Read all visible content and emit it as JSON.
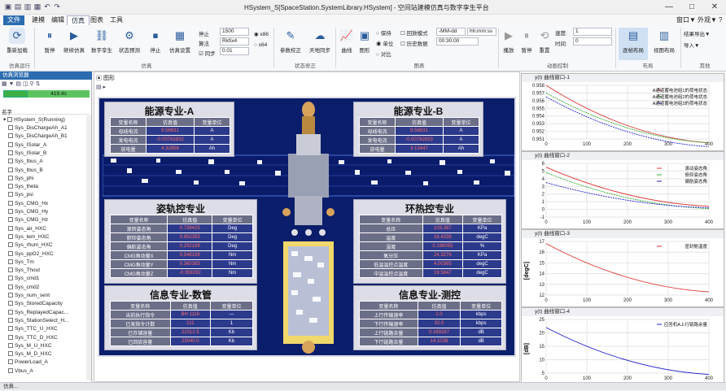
{
  "window": {
    "title": "HSystem_S[SpaceStation.SystemLibrary.HSystem] - 空间站建模仿真与数字孪生平台",
    "min": "—",
    "max": "□",
    "close": "✕"
  },
  "menu": [
    "文件",
    "建模",
    "编辑",
    "仿真",
    "图表",
    "工具"
  ],
  "menu_right": [
    "窗口▼",
    "外观▼",
    "?"
  ],
  "ribbon": {
    "buttons": [
      {
        "label": "重新加载",
        "icon": "reload-icon"
      },
      {
        "label": "暂停",
        "icon": "pause-icon"
      },
      {
        "label": "继续仿真",
        "icon": "play-icon"
      },
      {
        "label": "数字孪生",
        "icon": "link-icon"
      },
      {
        "label": "状态预测",
        "icon": "predict-icon"
      },
      {
        "label": "停止",
        "icon": "stop-icon"
      },
      {
        "label": "仿真设置",
        "icon": "settings-icon"
      }
    ],
    "stop_label": "停止",
    "stop_value": "1500",
    "algo_label": "算法",
    "algo_value": "Rkfix4",
    "step_label": "同步",
    "step_value": "0.01",
    "x86": "x86",
    "x64": "x64",
    "state_buttons": [
      {
        "label": "参数校正",
        "icon": "adjust-icon"
      },
      {
        "label": "天地同步",
        "icon": "cloud-icon"
      }
    ],
    "view_buttons": [
      {
        "label": "曲线",
        "icon": "curve-icon"
      },
      {
        "label": "图形",
        "icon": "shape-icon"
      }
    ],
    "radio": [
      "保持",
      "单位",
      "对比"
    ],
    "check_mode": "回放模式",
    "check_data": "历史数据",
    "date_fmt": "-MM-dd",
    "time_fmt": "hh:mm:ss",
    "time_value": "00:30:00",
    "play_buttons": [
      "播放",
      "暂停",
      "重置"
    ],
    "speed_label": "速度:",
    "speed_value": "1",
    "time_label": "时间:",
    "time_input": "0",
    "layout_buttons": [
      {
        "label": "逐帧布局",
        "icon": "layout-icon"
      },
      {
        "label": "视图布局",
        "icon": "view-icon"
      }
    ],
    "other_buttons": [
      "结果导出▼",
      "导入▼"
    ],
    "groups": [
      "仿真运行",
      "仿真",
      "状态修正",
      "图表",
      "动画控制",
      "布局",
      "其他"
    ]
  },
  "left": {
    "title": "仿真浏览器",
    "time": "419.4s",
    "col": "名字",
    "root": "HSystem_S(Running)",
    "items": [
      "Sys_DisChargeAh_A1",
      "Sys_DisChargeAh_B1",
      "Sys_ISolar_A",
      "Sys_ISolar_B",
      "Sys_Ibus_A",
      "Sys_Ibus_B",
      "Sys_phi",
      "Sys_theta",
      "Sys_psi",
      "Sys_CMG_Hx",
      "Sys_CMG_Hy",
      "Sys_CMG_Hz",
      "Sys_air_HXC",
      "Sys_tem_HXC",
      "Sys_rhum_HXC",
      "Sys_ppO2_HXC",
      "Sys_Tm",
      "Sys_Thout",
      "Sys_cmd1",
      "Sys_cmd2",
      "Sys_num_sent",
      "Sys_StoredCapacity",
      "Sys_ReplayedCapac...",
      "Sys_StationSelect_H...",
      "Sys_TTC_U_HXC",
      "Sys_TTC_D_HXC",
      "Sys_M_U_HXC",
      "Sys_M_D_HXC",
      "PowerLoad_A",
      "Vbus_A"
    ]
  },
  "center": {
    "tab": "图形",
    "panels": {
      "powerA": {
        "title": "能源专业-A",
        "head": [
          "变量名称",
          "仿真值",
          "变量单位"
        ],
        "rows": [
          [
            "母线电流",
            "9.56631",
            "A"
          ],
          [
            "发电电流",
            "-0.00782832",
            "A"
          ],
          [
            "放电量",
            "4.32856",
            "Ah"
          ]
        ]
      },
      "powerB": {
        "title": "能源专业-B",
        "head": [
          "变量名称",
          "仿真值",
          "变量单位"
        ],
        "rows": [
          [
            "母线电流",
            "9.56631",
            "A"
          ],
          [
            "发电电流",
            "-0.00782833",
            "A"
          ],
          [
            "放电量",
            "3.13447",
            "Ah"
          ]
        ]
      },
      "attitude": {
        "title": "姿轨控专业",
        "head": [
          "变量名称",
          "仿真值",
          "变量单位"
        ],
        "rows": [
          [
            "滚转姿态角",
            "0.739425",
            "Deg"
          ],
          [
            "俯仰姿态角",
            "0.952355",
            "Deg"
          ],
          [
            "偏航姿态角",
            "0.292189",
            "Deg"
          ],
          [
            "CMG角动量X",
            "0.548189",
            "Nm"
          ],
          [
            "CMG角动量Y",
            "0.360383",
            "Nm"
          ],
          [
            "CMG角动量Z",
            "-0.359292",
            "Nm"
          ]
        ]
      },
      "thermal": {
        "title": "环热控专业",
        "head": [
          "变量名称",
          "仿真值",
          "变量单位"
        ],
        "rows": [
          [
            "总压",
            "103.387",
            "KPa"
          ],
          [
            "温度",
            "16.4338",
            "degC"
          ],
          [
            "湿度",
            "0.198055",
            "%"
          ],
          [
            "氧分压",
            "24.3276",
            "KPa"
          ],
          [
            "低温温控点温度",
            "4.00365",
            "degC"
          ],
          [
            "中温温控点温度",
            "19.5847",
            "degC"
          ]
        ]
      },
      "data": {
        "title": "信息专业-数管",
        "head": [
          "变量名称",
          "仿真值",
          "变量单位"
        ],
        "rows": [
          [
            "当前执行指令",
            "BH 1116",
            "—"
          ],
          [
            "已发指令计数",
            "211",
            "1"
          ],
          [
            "已存储容量",
            "22312.5",
            "Kb"
          ],
          [
            "已回放容量",
            "23040.0",
            "Kb"
          ]
        ]
      },
      "ttc": {
        "title": "信息专业-测控",
        "head": [
          "变量名称",
          "仿真值",
          "变量单位"
        ],
        "rows": [
          [
            "上行传输速率",
            "2.0",
            "kbps"
          ],
          [
            "下行传输速率",
            "32.0",
            "kbps"
          ],
          [
            "上行链路余量",
            "0.169287",
            "dB"
          ],
          [
            "下行链路余量",
            "14.1038",
            "dB"
          ]
        ]
      }
    }
  },
  "right": {
    "charts": [
      {
        "title": "y(t) 曲线窗口-1",
        "legend": [
          "A通道蓄电池组1的荷电状态",
          "A通道蓄电池组2的荷电状态",
          "A通道蓄电池组3的荷电状态"
        ],
        "y_ticks": [
          "0.958",
          "0.957",
          "0.956",
          "0.955",
          "0.954",
          "0.953",
          "0.952",
          "0.951"
        ],
        "x_ticks": [
          "0",
          "100",
          "200",
          "300",
          "400"
        ],
        "ylabel": "",
        "color": [
          "#d33",
          "#3a3",
          "#22c"
        ]
      },
      {
        "title": "y(t) 曲线窗口-2",
        "legend": [
          "滚动姿态角",
          "俯仰姿态角",
          "偏航姿态角"
        ],
        "y_ticks": [
          "6",
          "5",
          "4",
          "3",
          "2",
          "1",
          "0",
          "-1"
        ],
        "x_ticks": [
          "0",
          "100",
          "200",
          "300",
          "400"
        ],
        "ylabel": "",
        "color": [
          "#d33",
          "#3a3",
          "#22c"
        ]
      },
      {
        "title": "y(t) 曲线窗口-3",
        "legend": [
          "密封舱温度"
        ],
        "y_ticks": [
          "17",
          "16",
          "15",
          "14",
          "13",
          "12"
        ],
        "x_ticks": [
          "0",
          "100",
          "200",
          "300",
          "400"
        ],
        "ylabel": "[degC]",
        "color": [
          "#d33"
        ]
      },
      {
        "title": "y(t) 曲线窗口-4",
        "legend": [
          "应答机A上行链路余量"
        ],
        "y_ticks": [
          "25",
          "20",
          "15",
          "10",
          "5"
        ],
        "x_ticks": [
          "0",
          "100",
          "200",
          "300",
          "400"
        ],
        "ylabel": "[dB]",
        "color": [
          "#22c"
        ]
      }
    ]
  },
  "status": "仿真..."
}
